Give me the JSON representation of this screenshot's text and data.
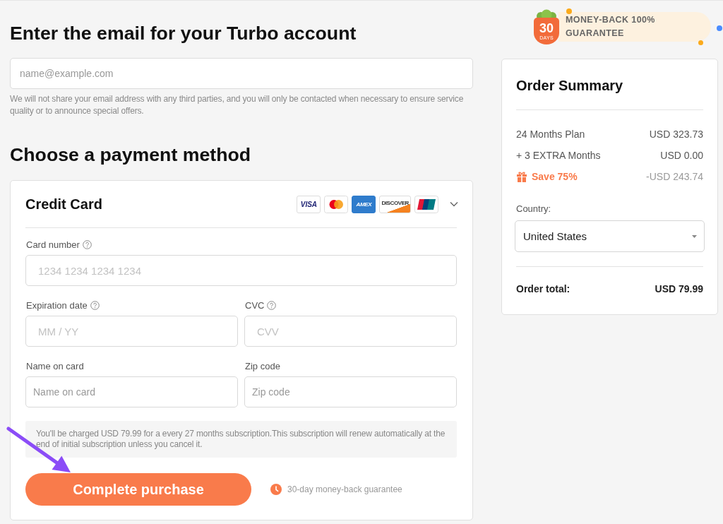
{
  "email_section": {
    "heading": "Enter the email for your Turbo account",
    "email_field": {
      "placeholder": "name@example.com"
    },
    "note": "We will not share your email address with any third parties, and you will only be contacted when necessary to ensure service quality or to announce special offers."
  },
  "payment_section": {
    "heading": "Choose a payment method",
    "method": {
      "title": "Credit Card",
      "expanded": true,
      "card_brands": [
        {
          "kind": "wordmark",
          "label": "VISA"
        },
        {
          "kind": "circles"
        },
        {
          "kind": "tile",
          "label": "AMEX"
        },
        {
          "kind": "swoosh",
          "label": "DISCOVER"
        },
        {
          "kind": "stripes"
        }
      ],
      "field_rows": [
        {
          "fields": [
            {
              "label": "Card number",
              "help_icon": true,
              "placeholder": "1234 1234 1234 1234",
              "kind": "secure"
            }
          ]
        },
        {
          "fields": [
            {
              "label": "Expiration date",
              "help_icon": true,
              "placeholder": "MM / YY",
              "kind": "secure"
            },
            {
              "label": "CVC",
              "help_icon": true,
              "placeholder": "CVV",
              "kind": "secure"
            }
          ]
        },
        {
          "fields": [
            {
              "label": "Name on card",
              "help_icon": false,
              "placeholder": "Name on card",
              "kind": "plain"
            },
            {
              "label": "Zip code",
              "help_icon": false,
              "placeholder": "Zip code",
              "kind": "plain"
            }
          ]
        }
      ],
      "notice": "You'll be charged USD 79.99 for a every 27 months subscription.This subscription will renew automatically at the end of initial subscription unless you cancel it.",
      "submit_button": "Complete purchase",
      "guarantee_note": "30-day money-back guarantee"
    }
  },
  "guarantee_badge": {
    "days": "30",
    "days_label": "DAYS",
    "text": "MONEY-BACK 100% GUARANTEE"
  },
  "order_summary": {
    "title": "Order Summary",
    "lines": [
      {
        "kind": "item",
        "label": "24 Months Plan",
        "amount": "USD 323.73"
      },
      {
        "kind": "item",
        "label": "+ 3 EXTRA Months",
        "amount": "USD 0.00"
      },
      {
        "kind": "discount",
        "label": "Save 75%",
        "amount": "-USD 243.74"
      }
    ],
    "country": {
      "label": "Country:",
      "value": "United States"
    },
    "total": {
      "label": "Order total:",
      "amount": "USD 79.99"
    }
  }
}
